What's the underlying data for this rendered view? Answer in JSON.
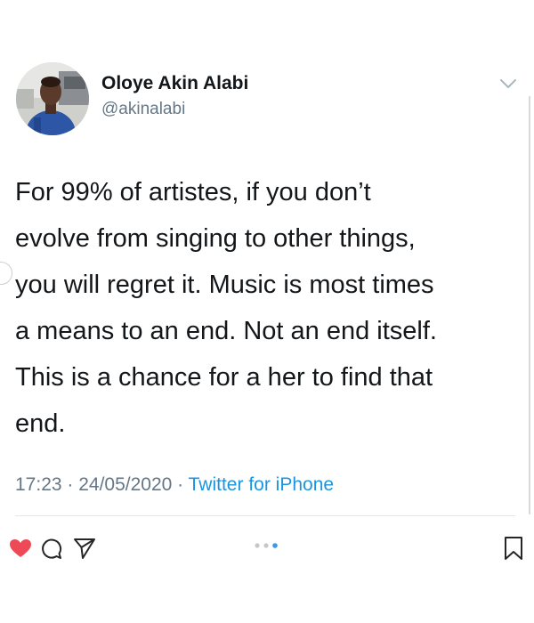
{
  "tweet": {
    "author": {
      "name": "Oloye Akin Alabi",
      "handle": "@akinalabi"
    },
    "text": "For 99% of artistes, if you don’t\nevolve from singing to other things,\nyou will regret it. Music is most times\na means to an end. Not an end itself.\nThis is a chance for a her to find that\nend.",
    "time": "17:23",
    "separator": " · ",
    "date": "24/05/2020",
    "source": "Twitter for iPhone"
  },
  "icons": {
    "more": "chevron-down-icon",
    "like": "heart-icon",
    "comment": "comment-icon",
    "share": "share-icon",
    "pager": "carousel-dots-icon",
    "save": "bookmark-icon"
  },
  "colors": {
    "text": "#14171a",
    "secondary": "#657786",
    "link": "#1b95e0",
    "like": "#ed4956",
    "pager_active": "#3897f0"
  },
  "carousel": {
    "slides": 3,
    "active_slide": 3
  }
}
